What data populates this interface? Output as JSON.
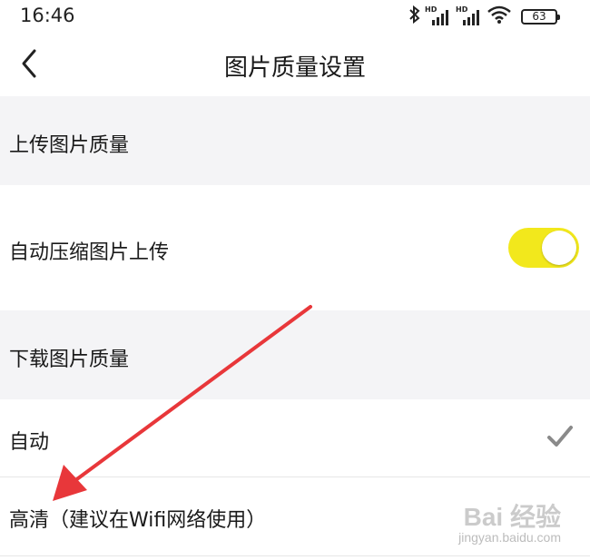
{
  "status_bar": {
    "time": "16:46",
    "hd_label_1": "HD",
    "hd_label_2": "HD",
    "battery": "63",
    "icons": [
      "bluetooth-icon",
      "signal-icon",
      "signal-icon",
      "wifi-icon",
      "battery-icon"
    ]
  },
  "nav": {
    "back_icon": "chevron-left-icon",
    "title": "图片质量设置"
  },
  "upload_section": {
    "header": "上传图片质量",
    "auto_compress_label": "自动压缩图片上传",
    "auto_compress_enabled": true
  },
  "download_section": {
    "header": "下载图片质量",
    "options": [
      {
        "label": "自动",
        "selected": true
      },
      {
        "label": "高清（建议在Wifi网络使用）",
        "selected": false
      }
    ]
  },
  "watermark": {
    "main": "Bai 经验",
    "sub": "jingyan.baidu.com"
  },
  "colors": {
    "toggle_on": "#f2e81c",
    "section_bg": "#f4f4f6",
    "check": "#8a8a8a",
    "arrow": "#e8373a"
  }
}
